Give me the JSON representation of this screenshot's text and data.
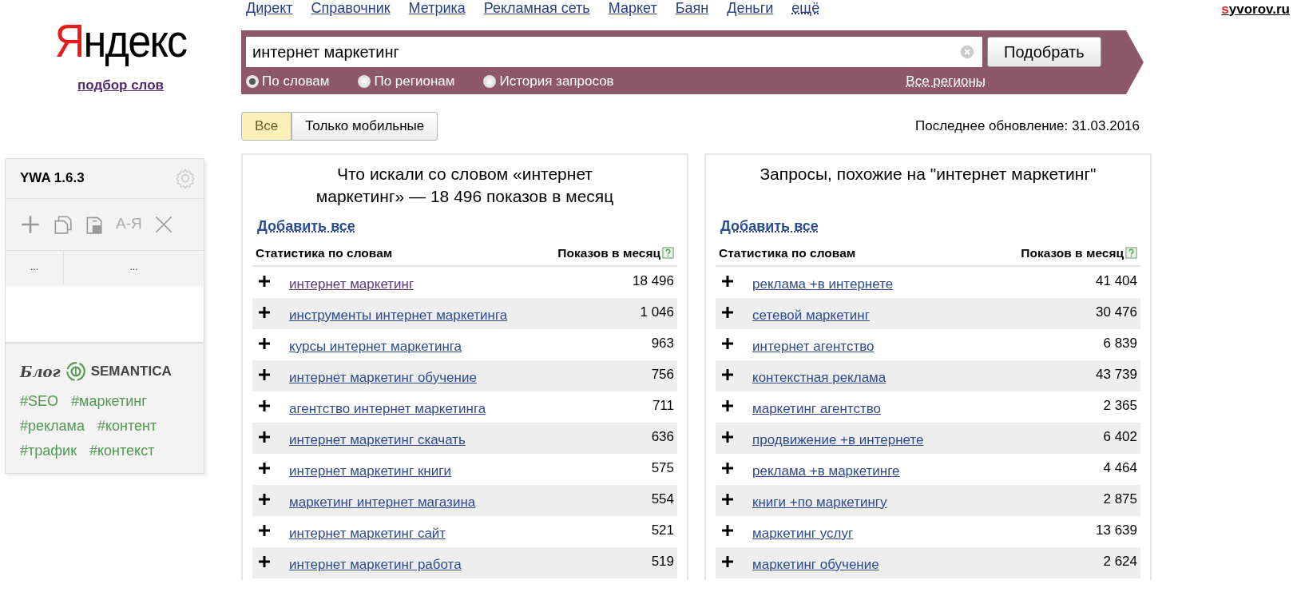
{
  "top_nav": [
    {
      "label": "Директ",
      "kind": "link"
    },
    {
      "label": "Справочник",
      "kind": "link"
    },
    {
      "label": "Метрика",
      "kind": "link"
    },
    {
      "label": "Рекламная сеть",
      "kind": "link"
    },
    {
      "label": "Маркет",
      "kind": "link"
    },
    {
      "label": "Баян",
      "kind": "link"
    },
    {
      "label": "Деньги",
      "kind": "link"
    },
    {
      "label": "ещё",
      "kind": "more"
    }
  ],
  "site_link": "syvorov.ru",
  "logo": {
    "text": "Яндекс",
    "subtitle": "подбор слов"
  },
  "search": {
    "value": "интернет маркетинг",
    "button": "Подобрать",
    "modes": [
      {
        "label": "По словам",
        "selected": true
      },
      {
        "label": "По регионам",
        "selected": false
      },
      {
        "label": "История запросов",
        "selected": false
      }
    ],
    "region": "Все регионы"
  },
  "device_filter": [
    {
      "label": "Все",
      "selected": true
    },
    {
      "label": "Только мобильные",
      "selected": false
    }
  ],
  "last_update": "Последнее обновление: 31.03.2016",
  "plugin": {
    "title": "YWA 1.6.3",
    "sort_label": "А-Я",
    "columns": [
      "...",
      "..."
    ],
    "blog": {
      "prefix": "Блог",
      "brand": "SEMANTICA",
      "tags": [
        "#SEO",
        "#маркетинг",
        "#реклама",
        "#контент",
        "#трафик",
        "#контекст"
      ]
    }
  },
  "panels": [
    {
      "title": "Что искали со словом «интернет маркетинг» — 18 496 показов в месяц",
      "add_all": "Добавить все",
      "col_phrase": "Статистика по словам",
      "col_count": "Показов в месяц",
      "rows": [
        {
          "phrase": "интернет маркетинг",
          "count": "18 496",
          "visited": true
        },
        {
          "phrase": "инструменты интернет маркетинга",
          "count": "1 046",
          "visited": false
        },
        {
          "phrase": "курсы интернет маркетинга",
          "count": "963",
          "visited": false
        },
        {
          "phrase": "интернет маркетинг обучение",
          "count": "756",
          "visited": false
        },
        {
          "phrase": "агентство интернет маркетинга",
          "count": "711",
          "visited": false
        },
        {
          "phrase": "интернет маркетинг скачать",
          "count": "636",
          "visited": false
        },
        {
          "phrase": "интернет маркетинг книги",
          "count": "575",
          "visited": false
        },
        {
          "phrase": "маркетинг интернет магазина",
          "count": "554",
          "visited": false
        },
        {
          "phrase": "интернет маркетинг сайт",
          "count": "521",
          "visited": false
        },
        {
          "phrase": "интернет маркетинг работа",
          "count": "519",
          "visited": false
        }
      ]
    },
    {
      "title": "Запросы, похожие на \"интернет маркетинг\"",
      "add_all": "Добавить все",
      "col_phrase": "Статистика по словам",
      "col_count": "Показов в месяц",
      "rows": [
        {
          "phrase": "реклама +в интернете",
          "count": "41 404",
          "visited": false
        },
        {
          "phrase": "сетевой маркетинг",
          "count": "30 476",
          "visited": false
        },
        {
          "phrase": "интернет агентство",
          "count": "6 839",
          "visited": false
        },
        {
          "phrase": "контекстная реклама",
          "count": "43 739",
          "visited": false
        },
        {
          "phrase": "маркетинг агентство",
          "count": "2 365",
          "visited": false
        },
        {
          "phrase": "продвижение +в интернете",
          "count": "6 402",
          "visited": false
        },
        {
          "phrase": "реклама +в маркетинге",
          "count": "4 464",
          "visited": false
        },
        {
          "phrase": "книги +по маркетингу",
          "count": "2 875",
          "visited": false
        },
        {
          "phrase": "маркетинг услуг",
          "count": "13 639",
          "visited": false
        },
        {
          "phrase": "маркетинг обучение",
          "count": "2 624",
          "visited": false
        }
      ]
    }
  ]
}
